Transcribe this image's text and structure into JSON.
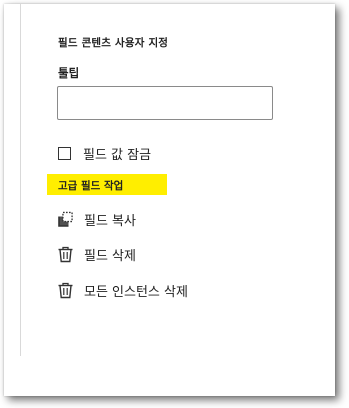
{
  "panel": {
    "section_title": "필드 콘텐츠 사용자 지정",
    "tooltip": {
      "label": "툴팁",
      "value": "",
      "placeholder": ""
    },
    "lock_field": {
      "label": "필드 값 잠금",
      "checked": false
    },
    "advanced": {
      "title": "고급 필드 작업",
      "highlight_color": "#ffee00",
      "actions": [
        {
          "label": "필드 복사",
          "icon": "copy-icon"
        },
        {
          "label": "필드 삭제",
          "icon": "trash-icon"
        },
        {
          "label": "모든 인스턴스 삭제",
          "icon": "trash-icon"
        }
      ]
    }
  }
}
